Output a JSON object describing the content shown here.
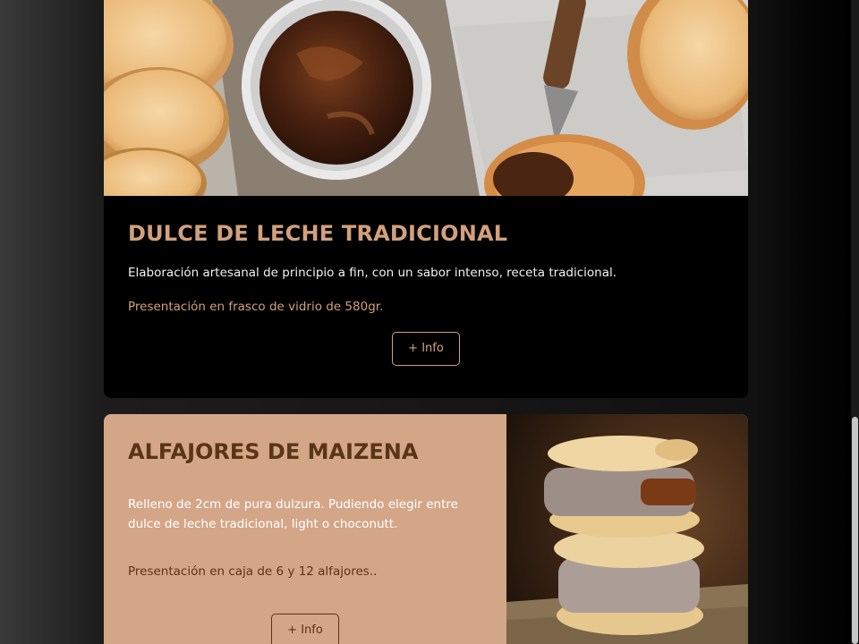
{
  "products": [
    {
      "title": "DULCE DE LECHE TRADICIONAL",
      "description": "Elaboración artesanal de principio a fin, con un sabor intenso, receta tradicional.",
      "presentation": "Presentación en frasco de vidrio de 580gr.",
      "button_label": "+ Info",
      "image": "dulce-de-leche-bowl-with-cookies-photo"
    },
    {
      "title": "ALFAJORES DE MAIZENA",
      "description": "Relleno de 2cm de pura dulzura. Pudiendo elegir entre dulce de leche tradicional, light o choconutt.",
      "presentation": "Presentación en caja de 6 y 12 alfajores..",
      "button_label": "+ Info",
      "image": "stacked-alfajores-photo"
    }
  ],
  "colors": {
    "accent_gold": "#d2a07c",
    "card_dark": "#000000",
    "card_tan": "#d4a688",
    "text_brown": "#5a3416"
  }
}
